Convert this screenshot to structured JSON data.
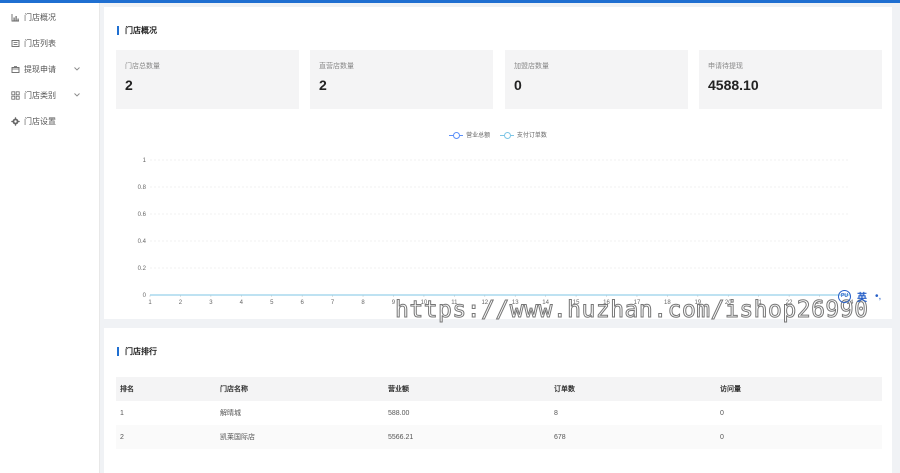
{
  "sidebar": {
    "items": [
      {
        "label": "门店概况",
        "icon": "bar-chart-icon",
        "has_children": false
      },
      {
        "label": "门店列表",
        "icon": "list-icon",
        "has_children": false
      },
      {
        "label": "提现申请",
        "icon": "wallet-icon",
        "has_children": true
      },
      {
        "label": "门店类别",
        "icon": "grid-icon",
        "has_children": true
      },
      {
        "label": "门店设置",
        "icon": "gear-icon",
        "has_children": false
      }
    ]
  },
  "overview": {
    "title": "门店概况",
    "cards": [
      {
        "label": "门店总数量",
        "value": "2"
      },
      {
        "label": "直营店数量",
        "value": "2"
      },
      {
        "label": "加盟店数量",
        "value": "0"
      },
      {
        "label": "申请待提现",
        "value": "4588.10"
      }
    ]
  },
  "chart_data": {
    "type": "line",
    "legend": [
      "营业总额",
      "支付订单数"
    ],
    "x": [
      "1",
      "2",
      "3",
      "4",
      "5",
      "6",
      "7",
      "8",
      "9",
      "10",
      "11",
      "12",
      "13",
      "14",
      "15",
      "16",
      "17",
      "18",
      "19",
      "20",
      "21",
      "22",
      "23",
      "24"
    ],
    "series": [
      {
        "name": "营业总额",
        "values": [
          0,
          0,
          0,
          0,
          0,
          0,
          0,
          0,
          0,
          0,
          0,
          0,
          0,
          0,
          0,
          0,
          0,
          0,
          0,
          0,
          0,
          0,
          0,
          0
        ],
        "color": "#5b8ff9"
      },
      {
        "name": "支付订单数",
        "values": [
          0,
          0,
          0,
          0,
          0,
          0,
          0,
          0,
          0,
          0,
          0,
          0,
          0,
          0,
          0,
          0,
          0,
          0,
          0,
          0,
          0,
          0,
          0,
          0
        ],
        "color": "#7ec6e6"
      }
    ],
    "yticks": [
      "0",
      "0.2",
      "0.4",
      "0.6",
      "0.8",
      "1"
    ],
    "ylim": [
      0,
      1
    ],
    "grid": true,
    "legend_position": "top-center"
  },
  "ranking": {
    "title": "门店排行",
    "columns": [
      "排名",
      "门店名称",
      "营业额",
      "订单数",
      "访问量"
    ],
    "rows": [
      [
        "1",
        "解晴城",
        "588.00",
        "8",
        "0"
      ],
      [
        "2",
        "凯莱国际店",
        "5566.21",
        "678",
        "0"
      ]
    ]
  },
  "watermark": "https://www.huzhan.com/ishop26990",
  "ime": {
    "badge": "PU",
    "lang": "英",
    "dots": "•,"
  },
  "colors": {
    "accent": "#1f6fd1",
    "line_primary": "#5b8ff9",
    "line_secondary": "#7ec6e6"
  }
}
